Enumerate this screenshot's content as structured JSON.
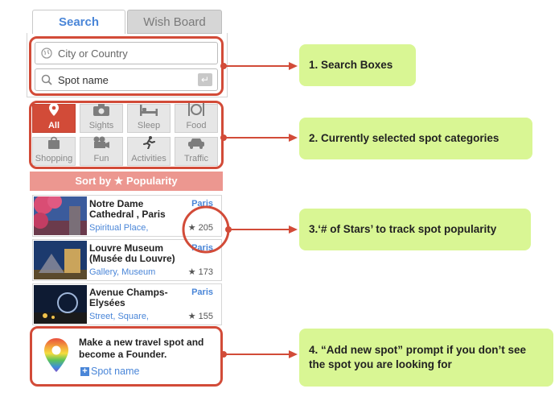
{
  "tabs": {
    "search": "Search",
    "wish_board": "Wish Board"
  },
  "search": {
    "city_placeholder": "City or Country",
    "spot_placeholder": "Spot name"
  },
  "categories": [
    {
      "label": "All",
      "icon": "pin-icon",
      "active": true
    },
    {
      "label": "Sights",
      "icon": "camera-icon"
    },
    {
      "label": "Sleep",
      "icon": "bed-icon"
    },
    {
      "label": "Food",
      "icon": "fork-knife-icon"
    },
    {
      "label": "Shopping",
      "icon": "shopping-bag-icon"
    },
    {
      "label": "Fun",
      "icon": "movie-camera-icon"
    },
    {
      "label": "Activities",
      "icon": "running-icon"
    },
    {
      "label": "Traffic",
      "icon": "car-icon"
    }
  ],
  "sort_label": "Sort by ★ Popularity",
  "spots": [
    {
      "title": "Notre Dame Cathedral , Paris",
      "city": "Paris",
      "tags": "Spiritual Place,",
      "stars": "★ 205"
    },
    {
      "title": "Louvre Museum (Musée du Louvre)",
      "city": "Paris",
      "tags": "Gallery, Museum",
      "stars": "★ 173"
    },
    {
      "title": "Avenue Champs-Elysées",
      "city": "Paris",
      "tags": "Street, Square,",
      "stars": "★ 155"
    }
  ],
  "add_spot": {
    "prompt": "Make a new travel spot and become a Founder.",
    "link": "Spot name"
  },
  "callouts": [
    "1. Search Boxes",
    "2. Currently selected spot categories",
    "3.‘# of Stars’ to track spot popularity",
    "4. “Add new spot” prompt if you don’t see the spot you are looking for"
  ],
  "colors": {
    "accent_red": "#d24b38",
    "link_blue": "#4a86d8",
    "callout_green": "#d9f694"
  }
}
